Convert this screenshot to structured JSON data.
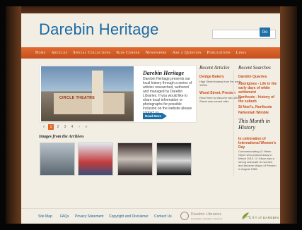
{
  "site": {
    "title": "Darebin Heritage"
  },
  "search": {
    "placeholder": "",
    "button_label": "Go"
  },
  "nav": {
    "items": [
      {
        "label": "Home"
      },
      {
        "label": "Articles"
      },
      {
        "label": "Special Collections"
      },
      {
        "label": "Kids Corner"
      },
      {
        "label": "Newspapers"
      },
      {
        "label": "Ask a Question"
      },
      {
        "label": "Publications"
      },
      {
        "label": "Links"
      }
    ]
  },
  "feature": {
    "sign_text": "CIRCLE   THEATRE",
    "title": "Darebin Heritage",
    "text": "Darebin Heritage presents our local history through a series of articles researched, authored and managed by Darebin Libraries. If you would like to share local information or photographs for possible inclusion on the website please contact us.",
    "read_more": "Read More"
  },
  "pager": {
    "prev_first": "«",
    "prev": "‹",
    "pages": [
      "1",
      "2",
      "3",
      "4"
    ],
    "next": "›",
    "next_last": "»",
    "active": "1"
  },
  "archives": {
    "heading": "Images from the Archives"
  },
  "recent_articles": {
    "heading": "Recent Articles",
    "items": [
      {
        "title": "Dvidge Bakery",
        "desc": "High Street bakery from the early 1900s"
      },
      {
        "title": "Wood Street, Preston",
        "desc": "Read here to discover who Wood Street was named after."
      }
    ]
  },
  "recent_searches": {
    "heading": "Recent Searches",
    "items": [
      "Darebin Quarries",
      "Aborigines - Life in the early days of white settlement",
      "Northcote - history of the suburb",
      "St Noel's, Northcote",
      "Nehemiah Wimble"
    ]
  },
  "month": {
    "heading": "This Month in History",
    "title": "In celebration of International Women's Day",
    "text": "Commemorating Cr Helen Glynn who passed away in March 2010. Cr Glynn was a strong advocate for women and became Mayor of Preston in August 1986."
  },
  "footer": {
    "links": [
      "Site Map",
      "FAQs",
      "Privacy Statement",
      "Copyright and Disclaimer",
      "Contact Us"
    ],
    "logo_darebin": {
      "name": "Darebin Libraries",
      "tagline": "knowledge | inspiration | pleasure"
    },
    "logo_city": {
      "text": "CITY of DAREBIN"
    }
  },
  "colors": {
    "accent": "#e06a2e",
    "link": "#c84b1d",
    "brand_blue": "#1a6aa6",
    "background": "#f3eee3"
  }
}
